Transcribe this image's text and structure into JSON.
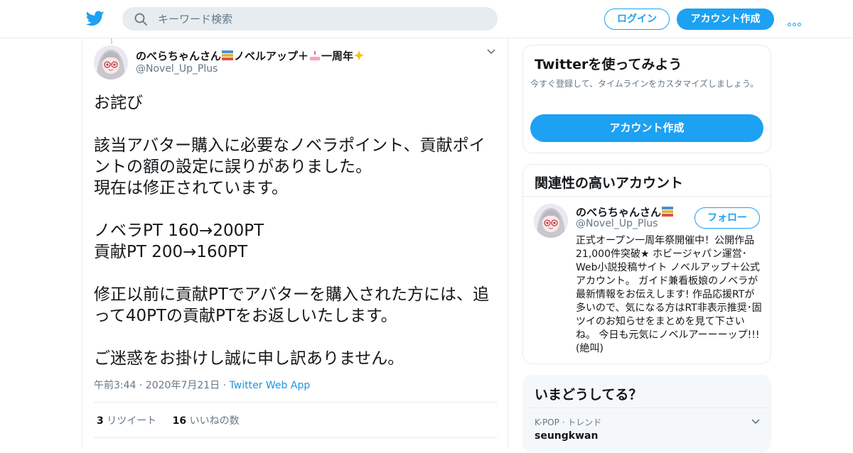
{
  "header": {
    "search_placeholder": "キーワード検索",
    "login_label": "ログイン",
    "signup_label": "アカウント作成"
  },
  "tweet": {
    "author_name_a": "のべらちゃんさん",
    "author_name_b": "ノベルアップ＋",
    "author_name_c": "一周年",
    "author_handle": "@Novel_Up_Plus",
    "text": "お詫び\n\n該当アバター購入に必要なノベラポイント、貢献ポイントの額の設定に誤りがありました。\n現在は修正されています。\n\nノベラPT 160→200PT\n貢献PT 200→160PT\n\n修正以前に貢献PTでアバターを購入された方には、追って40PTの貢献PTをお返しいたします。\n\nご迷惑をお掛けし誠に申し訳ありません。",
    "time": "午前3:44",
    "date": "2020年7月21日",
    "source": "Twitter Web App",
    "retweet_count": "3",
    "retweet_label": "リツイート",
    "like_count": "16",
    "like_label": "いいねの数"
  },
  "signup_card": {
    "title": "Twitterを使ってみよう",
    "subtitle": "今すぐ登録して、タイムラインをカスタマイズしましょう。",
    "button_label": "アカウント作成"
  },
  "related_card": {
    "title": "関連性の高いアカウント",
    "account_name": "のべらちゃんさん",
    "account_handle": "@Novel_Up_Plus",
    "follow_label": "フォロー",
    "bio": "正式オープン一周年祭開催中！公開作品21,000件突破★ ホビージャパン運営･Web小説投稿サイト ノベルアップ＋公式アカウント。 ガイド兼看板娘のノベラが最新情報をお伝えします! 作品応援RTが多いので、気になる方はRT非表示推奨･固ツイのお知らせをまとめを見て下さいね。 今日も元気にノベルアーーーップ!!!(絶叫)"
  },
  "trends_card": {
    "title": "いまどうしてる？",
    "trend_category": "K-POP · トレンド",
    "trend_name": "seungkwan"
  },
  "colors": {
    "accent": "#1da1f2",
    "text_primary": "#14171a",
    "text_secondary": "#657786",
    "border": "#e6ecf0"
  },
  "icons": [
    "twitter-bird-icon",
    "search-icon",
    "more-dots-icon",
    "chevron-down-icon",
    "books-emoji-icon",
    "cake-emoji-icon",
    "sparkles-emoji-icon"
  ]
}
